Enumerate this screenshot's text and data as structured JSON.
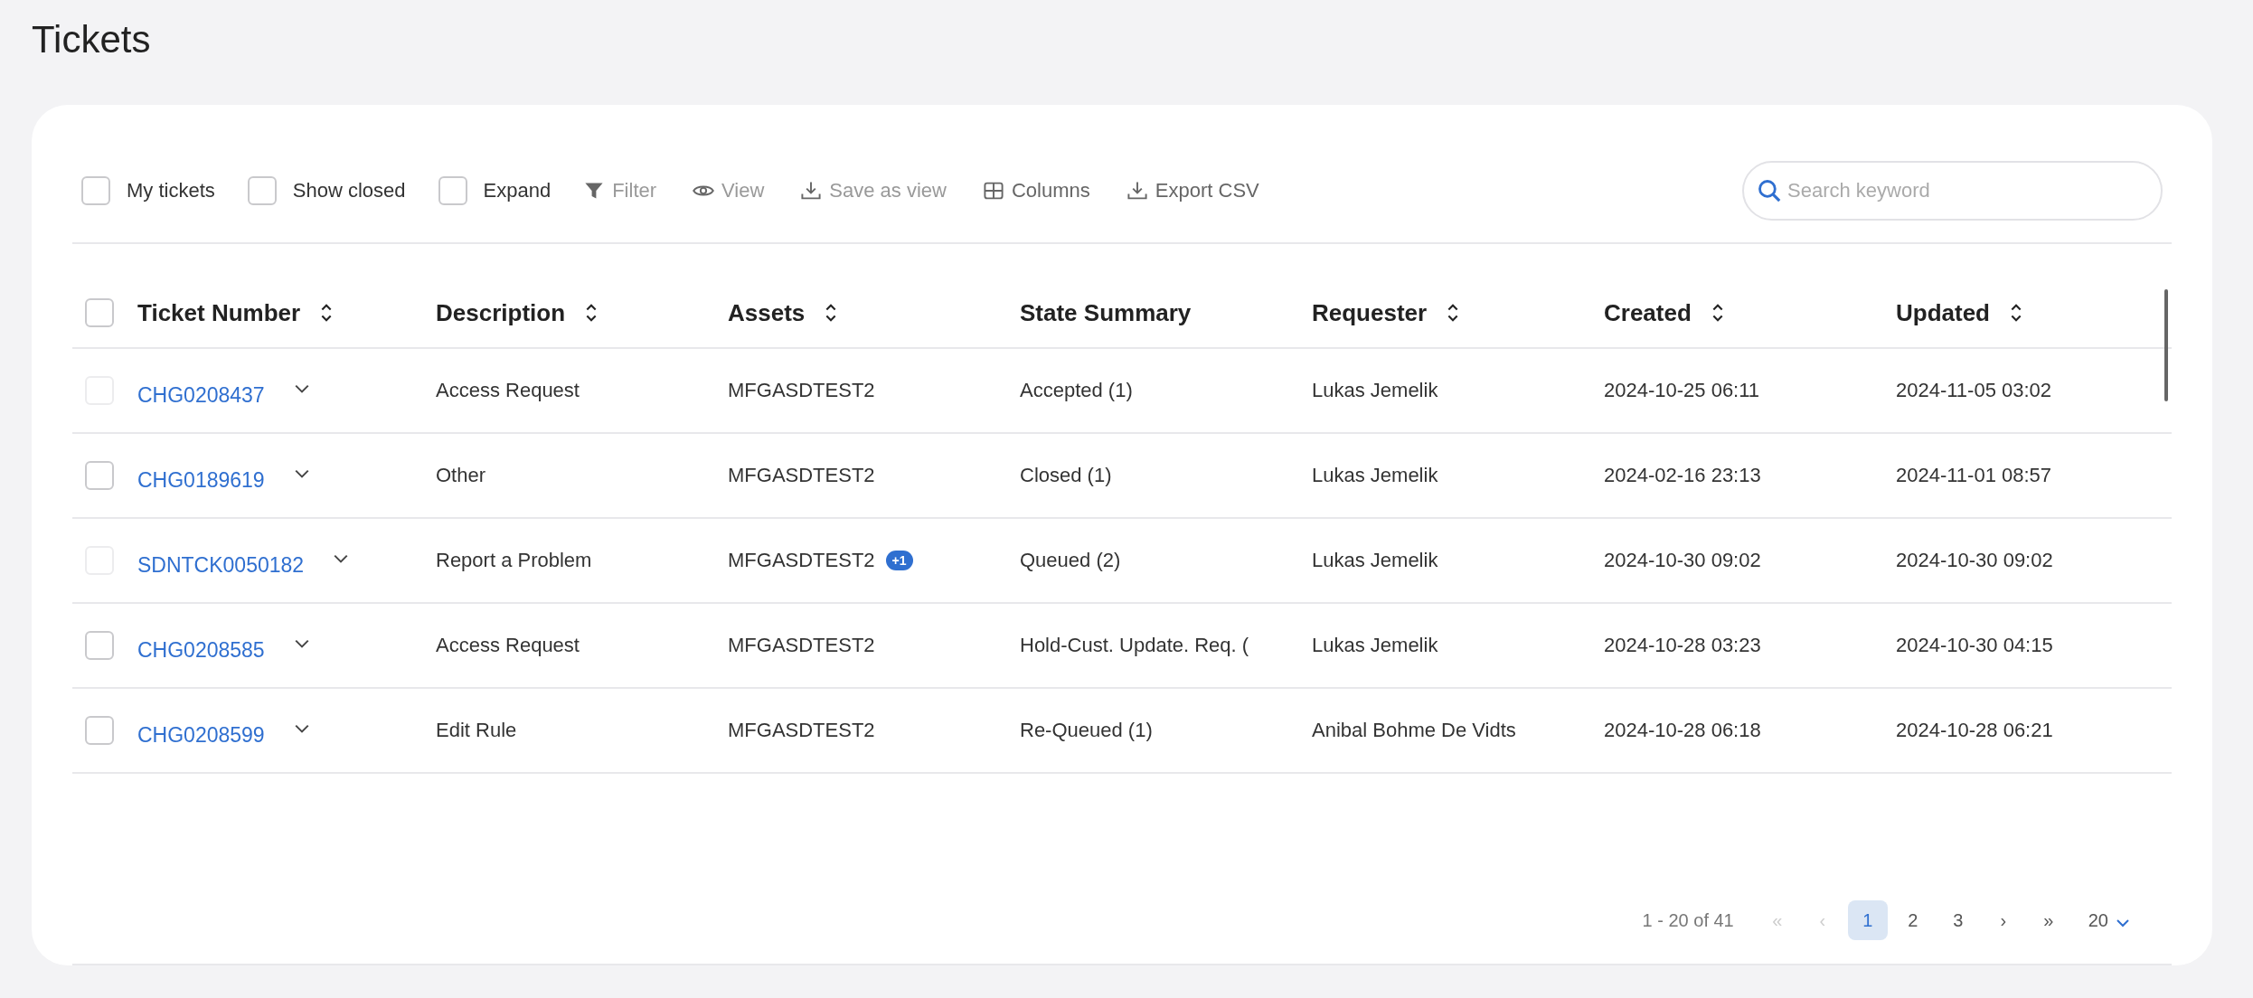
{
  "page": {
    "title": "Tickets"
  },
  "toolbar": {
    "checkboxes": [
      {
        "label": "My tickets",
        "checked": false
      },
      {
        "label": "Show closed",
        "checked": false
      },
      {
        "label": "Expand",
        "checked": false
      }
    ],
    "actions": [
      {
        "kind": "filter",
        "label": "Filter",
        "disabled": true
      },
      {
        "kind": "view",
        "label": "View",
        "disabled": true
      },
      {
        "kind": "save",
        "label": "Save as view",
        "disabled": true
      },
      {
        "kind": "columns",
        "label": "Columns",
        "disabled": false
      },
      {
        "kind": "export",
        "label": "Export CSV",
        "disabled": false
      }
    ],
    "search": {
      "placeholder": "Search keyword"
    }
  },
  "table": {
    "select_all": {
      "checked": false
    },
    "columns": [
      {
        "label": "Ticket Number",
        "sortable": true
      },
      {
        "label": "Description",
        "sortable": true
      },
      {
        "label": "Assets",
        "sortable": true
      },
      {
        "label": "State Summary",
        "sortable": false
      },
      {
        "label": "Requester",
        "sortable": true
      },
      {
        "label": "Created",
        "sortable": true
      },
      {
        "label": "Updated",
        "sortable": true
      }
    ],
    "rows": [
      {
        "checked": false,
        "disabled": true,
        "ticket": "CHG0208437",
        "description": "Access Request",
        "asset": "MFGASDTEST2",
        "state": "Accepted (1)",
        "requester": "Lukas Jemelik",
        "created": "2024-10-25 06:11",
        "updated": "2024-11-05 03:02"
      },
      {
        "checked": false,
        "disabled": false,
        "ticket": "CHG0189619",
        "description": "Other",
        "asset": "MFGASDTEST2",
        "state": "Closed (1)",
        "requester": "Lukas Jemelik",
        "created": "2024-02-16 23:13",
        "updated": "2024-11-01 08:57"
      },
      {
        "checked": false,
        "disabled": true,
        "ticket": "SDNTCK0050182",
        "description": "Report a Problem",
        "asset": "MFGASDTEST2",
        "asset_badge": "+1",
        "state": "Queued (2)",
        "requester": "Lukas Jemelik",
        "created": "2024-10-30 09:02",
        "updated": "2024-10-30 09:02"
      },
      {
        "checked": false,
        "disabled": false,
        "ticket": "CHG0208585",
        "description": "Access Request",
        "asset": "MFGASDTEST2",
        "state": "Hold-Cust. Update. Req. (",
        "requester": "Lukas Jemelik",
        "created": "2024-10-28 03:23",
        "updated": "2024-10-30 04:15"
      },
      {
        "checked": false,
        "disabled": false,
        "ticket": "CHG0208599",
        "description": "Edit Rule",
        "asset": "MFGASDTEST2",
        "state": "Re-Queued (1)",
        "requester": "Anibal Bohme De Vidts",
        "created": "2024-10-28 06:18",
        "updated": "2024-10-28 06:21"
      }
    ]
  },
  "pagination": {
    "summary": "1 - 20 of 41",
    "first": {
      "label": "«",
      "disabled": true
    },
    "prev": {
      "label": "‹",
      "disabled": true
    },
    "pages": [
      {
        "label": "1",
        "selected": true
      },
      {
        "label": "2",
        "selected": false
      },
      {
        "label": "3",
        "selected": false
      }
    ],
    "next": {
      "label": "›",
      "disabled": false
    },
    "last": {
      "label": "»",
      "disabled": false
    },
    "page_size": "20"
  }
}
